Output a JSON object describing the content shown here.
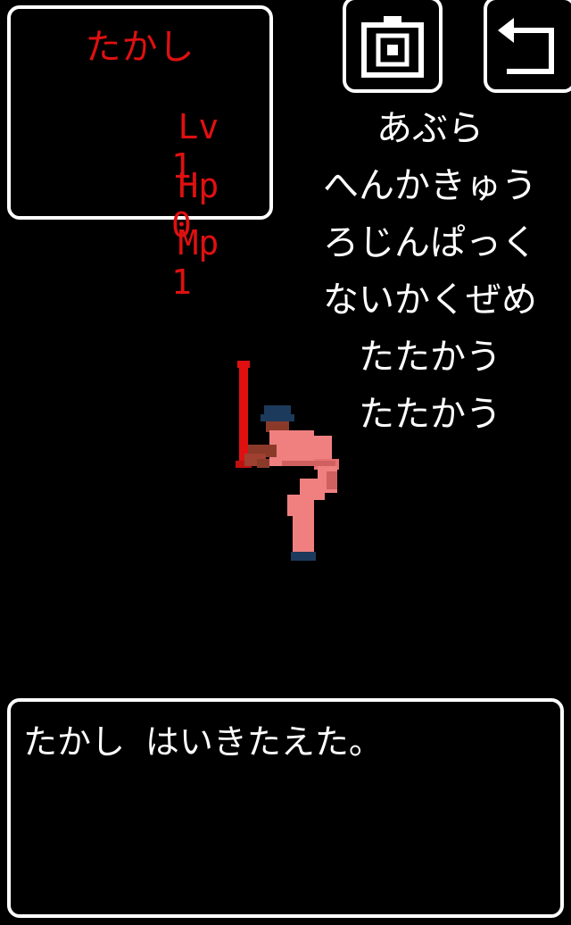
{
  "status": {
    "name": "たかし",
    "lv_label": "Lv",
    "lv_value": "1",
    "hp_label": "Hp",
    "hp_value": "0",
    "mp_label": "Mp",
    "mp_value": "1"
  },
  "icons": {
    "camera": "camera-icon",
    "back": "back-arrow-icon"
  },
  "commands": [
    "あぶら",
    "へんかきゅう",
    "ろじんぱっく",
    "ないかくぜめ",
    "たたかう",
    "たたかう"
  ],
  "message": {
    "text": "たかし はいきたえた。"
  },
  "colors": {
    "background": "#000000",
    "status_text": "#e01010",
    "border": "#ffffff",
    "bat": "#e01010",
    "uniform": "#f08080",
    "cap": "#1c3a5c"
  }
}
